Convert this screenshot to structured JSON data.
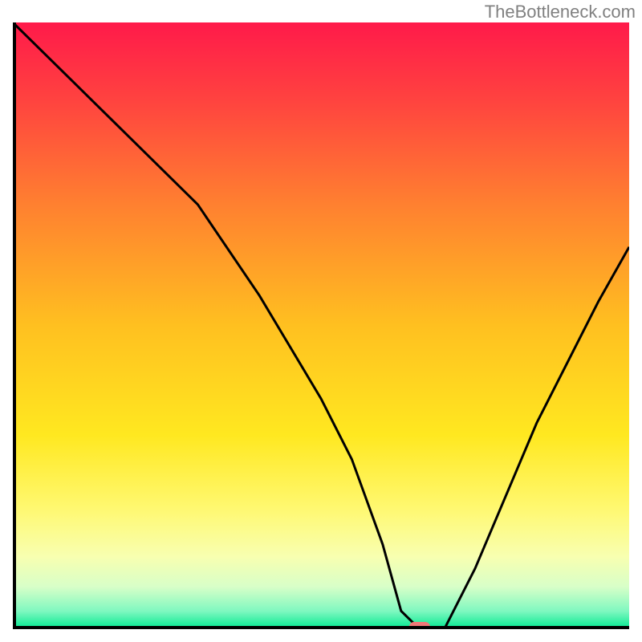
{
  "watermark": "TheBottleneck.com",
  "chart_data": {
    "type": "line",
    "title": "",
    "xlabel": "",
    "ylabel": "",
    "x_range": [
      0,
      100
    ],
    "y_range": [
      0,
      100
    ],
    "series": [
      {
        "name": "bottleneck-curve",
        "x": [
          0,
          10,
          20,
          30,
          40,
          50,
          55,
          60,
          63,
          66,
          70,
          75,
          80,
          85,
          90,
          95,
          100
        ],
        "y": [
          100,
          90,
          80,
          70,
          55,
          38,
          28,
          14,
          3,
          0,
          0,
          10,
          22,
          34,
          44,
          54,
          63
        ]
      }
    ],
    "marker": {
      "name": "highlight-marker",
      "x": 66,
      "y": 0,
      "color": "#f07878"
    },
    "gradient_stops": [
      {
        "offset": 0.0,
        "color": "#ff1a4a"
      },
      {
        "offset": 0.12,
        "color": "#ff4040"
      },
      {
        "offset": 0.3,
        "color": "#ff8030"
      },
      {
        "offset": 0.5,
        "color": "#ffc020"
      },
      {
        "offset": 0.68,
        "color": "#ffe820"
      },
      {
        "offset": 0.8,
        "color": "#fff870"
      },
      {
        "offset": 0.88,
        "color": "#f8ffb0"
      },
      {
        "offset": 0.93,
        "color": "#d8ffc8"
      },
      {
        "offset": 0.97,
        "color": "#80f8c0"
      },
      {
        "offset": 1.0,
        "color": "#00e890"
      }
    ]
  }
}
